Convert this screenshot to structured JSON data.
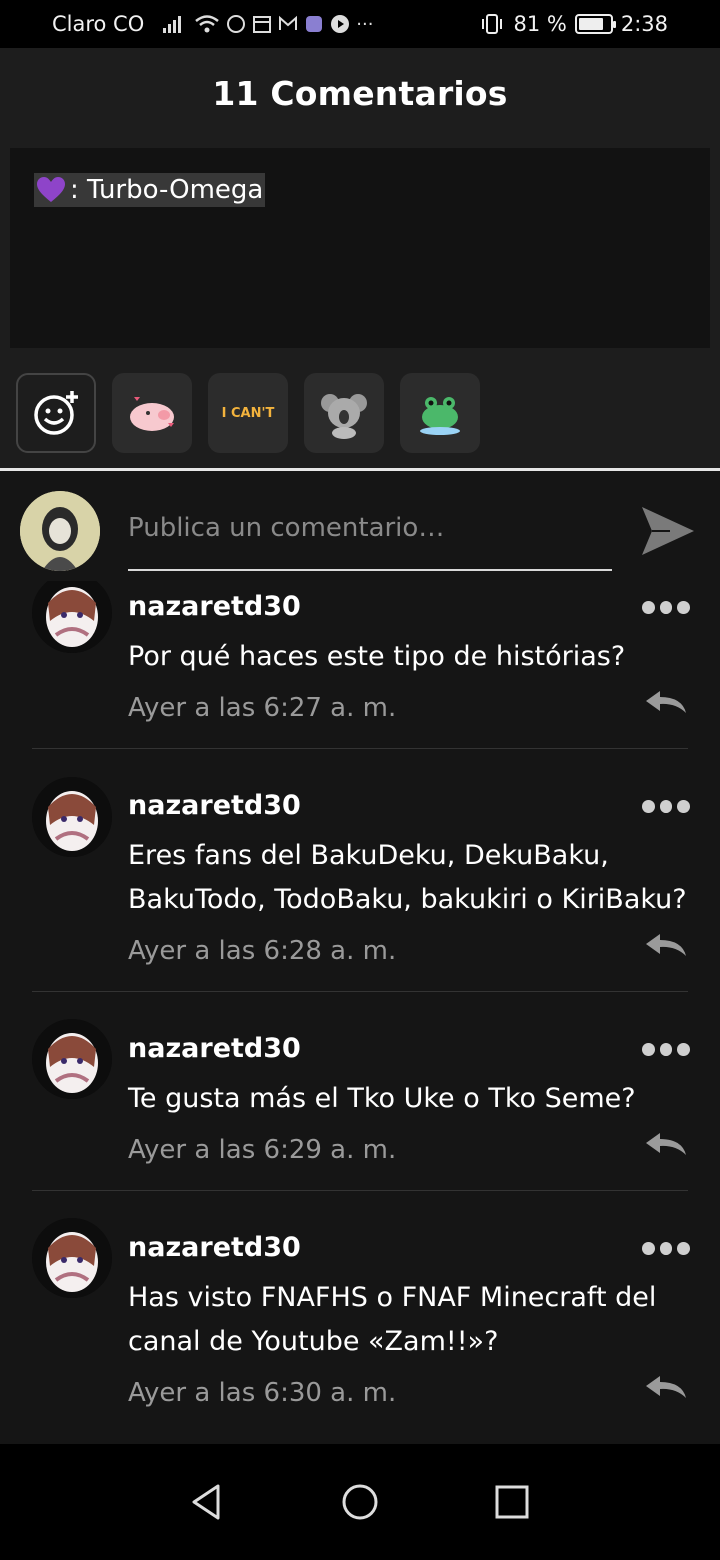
{
  "status_bar": {
    "carrier": "Claro CO",
    "battery_percent": "81 %",
    "battery_level": 0.81,
    "time": "2:38"
  },
  "header": {
    "title": "11 Comentarios"
  },
  "post": {
    "text": ": Turbo-Omega",
    "emoji": "purple-heart"
  },
  "stickers": [
    {
      "name": "smiley-add-icon"
    },
    {
      "name": "pig-sticker"
    },
    {
      "name": "i-cant-sticker",
      "label": "I CAN'T"
    },
    {
      "name": "koala-sticker"
    },
    {
      "name": "frog-sticker"
    }
  ],
  "composer": {
    "placeholder": "Publica un comentario…"
  },
  "comments": [
    {
      "user": "nazaretd30",
      "text": "Por qué haces este tipo de histórias?",
      "time": "Ayer a las 6:27 a. m."
    },
    {
      "user": "nazaretd30",
      "text": "Eres fans del BakuDeku, DekuBaku, BakuTodo, TodoBaku, bakukiri o KiriBaku?",
      "time": "Ayer a las 6:28 a. m."
    },
    {
      "user": "nazaretd30",
      "text": "Te gusta más el Tko Uke o Tko Seme?",
      "time": "Ayer a las 6:29 a. m."
    },
    {
      "user": "nazaretd30",
      "text": "Has visto FNAFHS o FNAF Minecraft del canal de Youtube «Zam!!»?",
      "time": "Ayer a las 6:30 a. m."
    }
  ],
  "colors": {
    "background": "#151515",
    "header": "#1d1d1d",
    "accent_heart": "#8e44c9"
  }
}
